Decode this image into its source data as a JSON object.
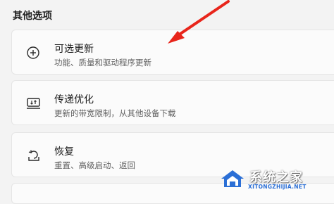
{
  "section": {
    "title": "其他选项"
  },
  "cards": [
    {
      "icon": "plus-circle-icon",
      "title": "可选更新",
      "subtitle": "功能、质量和驱动程序更新"
    },
    {
      "icon": "delivery-optimization-icon",
      "title": "传递优化",
      "subtitle": "更新的带宽限制，从其他设备下载"
    },
    {
      "icon": "recovery-icon",
      "title": "恢复",
      "subtitle": "重置、高级启动、返回"
    }
  ],
  "watermark": {
    "title": "系统之家",
    "url": "XITONGZHIJIA.NET"
  },
  "colors": {
    "arrow": "#e8251b",
    "background": "#f3f3f3",
    "card": "#fbfbfb",
    "watermark_blue": "#2b6fd6"
  }
}
